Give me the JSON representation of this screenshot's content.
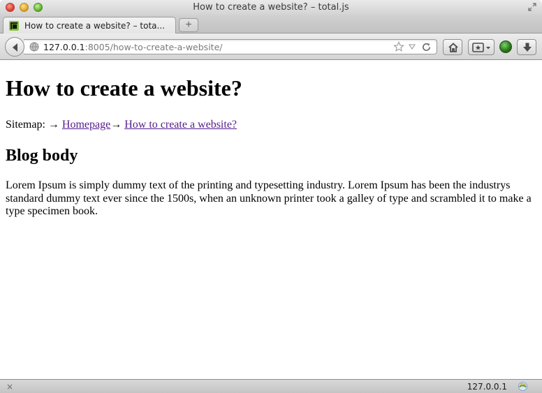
{
  "window": {
    "title": "How to create a website? – total.js"
  },
  "tabs": [
    {
      "label": "How to create a website? – tota...",
      "active": true,
      "icon": "totaljs-favicon-icon"
    }
  ],
  "tabstrip": {
    "new_tab_label": "+"
  },
  "navbar": {
    "url_host": "127.0.0.1",
    "url_rest": ":8005/how-to-create-a-website/",
    "icons": [
      "back-icon",
      "globe-icon",
      "bookmark-star-icon",
      "dropdown-icon",
      "reload-icon",
      "home-icon",
      "bookmarks-icon",
      "addon-icon",
      "downloads-icon"
    ]
  },
  "page": {
    "title": "How to create a website?",
    "sitemap_prefix": "Sitemap: →",
    "sitemap_links": [
      {
        "label": "Homepage"
      },
      {
        "label": "How to create a website?"
      }
    ],
    "sitemap_separator": "→",
    "section_heading": "Blog body",
    "body": "Lorem Ipsum is simply dummy text of the printing and typesetting industry. Lorem Ipsum has been the industrys standard dummy text ever since the 1500s, when an unknown printer took a galley of type and scrambled it to make a type specimen book."
  },
  "statusbar": {
    "close_label": "×",
    "host": "127.0.0.1"
  },
  "colors": {
    "visited_link": "#551a8b",
    "text": "#000000"
  }
}
